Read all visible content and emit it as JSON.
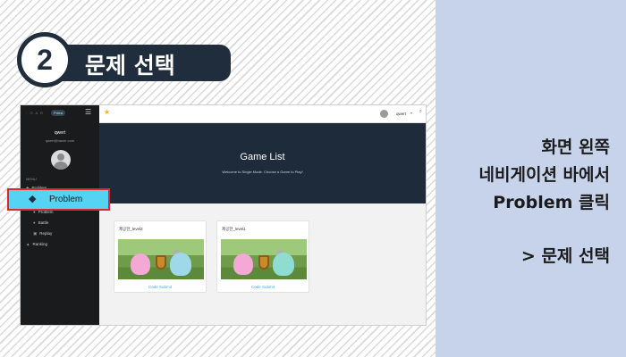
{
  "step": {
    "number": "2",
    "title": "문제 선택"
  },
  "instructions": {
    "line1": "화면 왼쪽",
    "line2": "네비게이션 바에서",
    "line3": "Problem 클릭",
    "result": "> 문제 선택"
  },
  "app": {
    "sidebar": {
      "logo": "· O A R",
      "level_badge": "Prtest",
      "username": "qwert",
      "email": "qwert@naver.com",
      "menu_label": "MENU",
      "items": [
        {
          "label": "Problem",
          "icon": "graduation-cap-icon"
        },
        {
          "label": "Problem",
          "icon": "user-icon"
        },
        {
          "label": "Battle",
          "icon": "user-icon"
        },
        {
          "label": "Replay",
          "icon": "film-icon"
        },
        {
          "label": "Ranking",
          "icon": "thumbs-up-icon"
        }
      ]
    },
    "topbar": {
      "user": "qwert",
      "caret": "▾",
      "search_icon": "search-icon",
      "star_icon": "star-icon"
    },
    "banner": {
      "title": "Game List",
      "subtitle": "Welcome to Single Mode. Choose a Game to Play!"
    },
    "cards": [
      {
        "title": "제공한_level2",
        "button": "Code Submit"
      },
      {
        "title": "제공한_level1",
        "button": "Code Submit"
      }
    ]
  },
  "highlight": {
    "label": "Problem",
    "icon": "graduation-cap-icon",
    "border_color": "#e0252b",
    "fill_color": "#55d3f3"
  }
}
